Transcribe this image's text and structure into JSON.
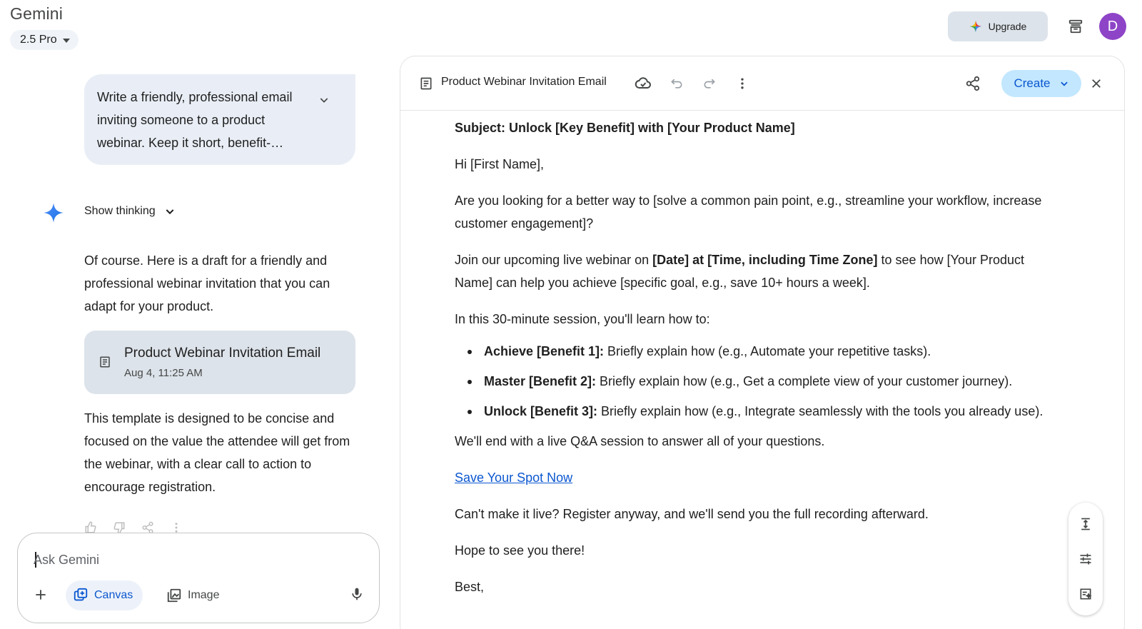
{
  "app": {
    "title": "Gemini",
    "model": "2.5 Pro"
  },
  "header": {
    "upgrade_label": "Upgrade",
    "avatar_letter": "D"
  },
  "chat": {
    "user_prompt": "Write a friendly, professional email inviting someone to a product webinar. Keep it short, benefit-focused, and include a clear call to action.",
    "show_thinking_label": "Show thinking",
    "response_intro": "Of course. Here is a draft for a friendly and professional webinar invitation that you can adapt for your product.",
    "doc_card": {
      "title": "Product Webinar Invitation Email",
      "date": "Aug 4, 11:25 AM"
    },
    "response_outro": "This template is designed to be concise and focused on the value the attendee will get from the webinar, with a clear call to action to encourage registration."
  },
  "input": {
    "placeholder": "Ask Gemini",
    "canvas_label": "Canvas",
    "image_label": "Image"
  },
  "canvas": {
    "title": "Product Webinar Invitation Email",
    "create_label": "Create",
    "doc": {
      "subject": "Subject: Unlock [Key Benefit] with [Your Product Name]",
      "greeting": "Hi [First Name],",
      "para1": "Are you looking for a better way to [solve a common pain point, e.g., streamline your workflow, increase customer engagement]?",
      "para2_pre": "Join our upcoming live webinar on ",
      "para2_bold": "[Date] at [Time, including Time Zone]",
      "para2_post": " to see how [Your Product Name] can help you achieve [specific goal, e.g., save 10+ hours a week].",
      "para3": "In this 30-minute session, you'll learn how to:",
      "bullets": [
        {
          "bold": "Achieve [Benefit 1]:",
          "text": " Briefly explain how (e.g., Automate your repetitive tasks)."
        },
        {
          "bold": "Master [Benefit 2]:",
          "text": " Briefly explain how (e.g., Get a complete view of your customer journey)."
        },
        {
          "bold": "Unlock [Benefit 3]:",
          "text": " Briefly explain how (e.g., Integrate seamlessly with the tools you already use)."
        }
      ],
      "para4": "We'll end with a live Q&A session to answer all of your questions.",
      "cta_link": "Save Your Spot Now",
      "para5": "Can't make it live? Register anyway, and we'll send you the full recording afterward.",
      "para6": "Hope to see you there!",
      "signoff": "Best,"
    }
  },
  "colors": {
    "accent": "#0b57d0",
    "create_bg": "#c2e7ff",
    "avatar": "#8e44c7",
    "bubble": "#e9eef6"
  }
}
